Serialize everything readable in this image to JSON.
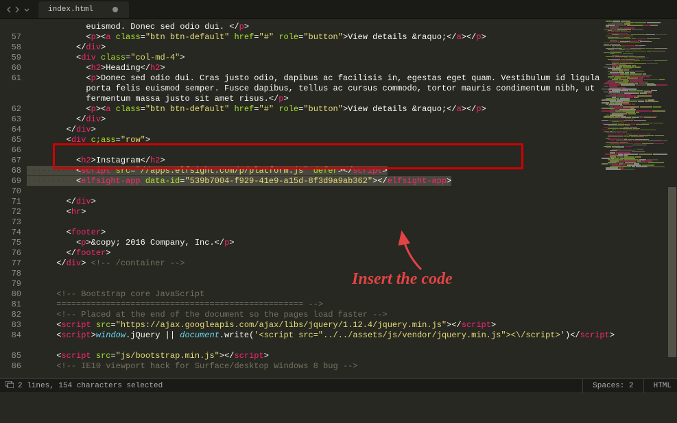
{
  "tab": {
    "filename": "index.html",
    "modified": true
  },
  "annotation": {
    "text": "Insert the code"
  },
  "status": {
    "selection_icon": "⧉",
    "selection": "2 lines, 154 characters selected",
    "spaces": "Spaces: 2",
    "syntax": "HTML"
  },
  "gutter": [
    "",
    "57",
    "58",
    "59",
    "60",
    "61",
    "",
    "",
    "62",
    "63",
    "64",
    "65",
    "66",
    "67",
    "68",
    "69",
    "70",
    "71",
    "72",
    "73",
    "74",
    "75",
    "76",
    "77",
    "78",
    "79",
    "80",
    "81",
    "82",
    "83",
    "84",
    "",
    "85",
    "86",
    ""
  ],
  "lines": [
    {
      "indent": 12,
      "t": [
        [
          "txt",
          "euismod. Donec sed odio dui. "
        ],
        [
          "punct",
          "</"
        ],
        [
          "tag",
          "p"
        ],
        [
          "punct",
          ">"
        ]
      ]
    },
    {
      "indent": 12,
      "t": [
        [
          "punct",
          "<"
        ],
        [
          "tag",
          "p"
        ],
        [
          "punct",
          "><"
        ],
        [
          "tag",
          "a"
        ],
        [
          "txt",
          " "
        ],
        [
          "attr",
          "class"
        ],
        [
          "punct",
          "="
        ],
        [
          "str",
          "\"btn btn-default\""
        ],
        [
          "txt",
          " "
        ],
        [
          "attr",
          "href"
        ],
        [
          "punct",
          "="
        ],
        [
          "str",
          "\"#\""
        ],
        [
          "txt",
          " "
        ],
        [
          "attr",
          "role"
        ],
        [
          "punct",
          "="
        ],
        [
          "str",
          "\"button\""
        ],
        [
          "punct",
          ">"
        ],
        [
          "txt",
          "View details &raquo;"
        ],
        [
          "punct",
          "</"
        ],
        [
          "tag",
          "a"
        ],
        [
          "punct",
          "></"
        ],
        [
          "tag",
          "p"
        ],
        [
          "punct",
          ">"
        ]
      ]
    },
    {
      "indent": 10,
      "t": [
        [
          "punct",
          "</"
        ],
        [
          "tag",
          "div"
        ],
        [
          "punct",
          ">"
        ]
      ]
    },
    {
      "indent": 10,
      "t": [
        [
          "punct",
          "<"
        ],
        [
          "tag",
          "div"
        ],
        [
          "txt",
          " "
        ],
        [
          "attr",
          "class"
        ],
        [
          "punct",
          "="
        ],
        [
          "str",
          "\"col-md-4\""
        ],
        [
          "punct",
          ">"
        ]
      ]
    },
    {
      "indent": 12,
      "t": [
        [
          "punct",
          "<"
        ],
        [
          "tag",
          "h2"
        ],
        [
          "punct",
          ">"
        ],
        [
          "txt",
          "Heading"
        ],
        [
          "punct",
          "</"
        ],
        [
          "tag",
          "h2"
        ],
        [
          "punct",
          ">"
        ]
      ]
    },
    {
      "indent": 12,
      "t": [
        [
          "punct",
          "<"
        ],
        [
          "tag",
          "p"
        ],
        [
          "punct",
          ">"
        ],
        [
          "txt",
          "Donec sed odio dui. Cras justo odio, dapibus ac facilisis in, egestas eget quam. Vestibulum id ligula"
        ]
      ]
    },
    {
      "indent": 12,
      "t": [
        [
          "txt",
          "porta felis euismod semper. Fusce dapibus, tellus ac cursus commodo, tortor mauris condimentum nibh, ut"
        ]
      ]
    },
    {
      "indent": 12,
      "t": [
        [
          "txt",
          "fermentum massa justo sit amet risus."
        ],
        [
          "punct",
          "</"
        ],
        [
          "tag",
          "p"
        ],
        [
          "punct",
          ">"
        ]
      ]
    },
    {
      "indent": 12,
      "t": [
        [
          "punct",
          "<"
        ],
        [
          "tag",
          "p"
        ],
        [
          "punct",
          "><"
        ],
        [
          "tag",
          "a"
        ],
        [
          "txt",
          " "
        ],
        [
          "attr",
          "class"
        ],
        [
          "punct",
          "="
        ],
        [
          "str",
          "\"btn btn-default\""
        ],
        [
          "txt",
          " "
        ],
        [
          "attr",
          "href"
        ],
        [
          "punct",
          "="
        ],
        [
          "str",
          "\"#\""
        ],
        [
          "txt",
          " "
        ],
        [
          "attr",
          "role"
        ],
        [
          "punct",
          "="
        ],
        [
          "str",
          "\"button\""
        ],
        [
          "punct",
          ">"
        ],
        [
          "txt",
          "View details &raquo;"
        ],
        [
          "punct",
          "</"
        ],
        [
          "tag",
          "a"
        ],
        [
          "punct",
          "></"
        ],
        [
          "tag",
          "p"
        ],
        [
          "punct",
          ">"
        ]
      ]
    },
    {
      "indent": 10,
      "t": [
        [
          "punct",
          "</"
        ],
        [
          "tag",
          "div"
        ],
        [
          "punct",
          ">"
        ]
      ]
    },
    {
      "indent": 8,
      "t": [
        [
          "punct",
          "</"
        ],
        [
          "tag",
          "div"
        ],
        [
          "punct",
          ">"
        ]
      ]
    },
    {
      "indent": 8,
      "t": [
        [
          "punct",
          "<"
        ],
        [
          "tag",
          "div"
        ],
        [
          "txt",
          " "
        ],
        [
          "attr",
          "c;ass"
        ],
        [
          "punct",
          "="
        ],
        [
          "str",
          "\"row\""
        ],
        [
          "punct",
          ">"
        ]
      ]
    },
    {
      "indent": 0,
      "t": []
    },
    {
      "indent": 10,
      "t": [
        [
          "punct",
          "<"
        ],
        [
          "tag",
          "h2"
        ],
        [
          "punct",
          ">"
        ],
        [
          "txt",
          "Instagram"
        ],
        [
          "punct",
          "</"
        ],
        [
          "tag",
          "h2"
        ],
        [
          "punct",
          ">"
        ]
      ]
    },
    {
      "indent": 0,
      "sel": true,
      "ws": "··········",
      "t": [
        [
          "punct",
          "<"
        ],
        [
          "tag",
          "script"
        ],
        [
          "ws",
          "·"
        ],
        [
          "attr",
          "src"
        ],
        [
          "punct",
          "="
        ],
        [
          "str",
          "\"//apps.elfsight.com/p/platform.js\""
        ],
        [
          "ws",
          "·"
        ],
        [
          "attr",
          "defer"
        ],
        [
          "punct",
          "></"
        ],
        [
          "tag",
          "script"
        ],
        [
          "punct",
          ">"
        ]
      ]
    },
    {
      "indent": 0,
      "sel": true,
      "ws": "··········",
      "t": [
        [
          "punct",
          "<"
        ],
        [
          "tag",
          "elfsight-app"
        ],
        [
          "ws",
          "·"
        ],
        [
          "attr",
          "data-id"
        ],
        [
          "punct",
          "="
        ],
        [
          "str",
          "\"539b7004-f929-41e9-a15d-8f3d9a9ab362\""
        ],
        [
          "punct",
          "></"
        ],
        [
          "tag",
          "elfsight-app"
        ],
        [
          "punct",
          ">"
        ]
      ]
    },
    {
      "indent": 0,
      "t": []
    },
    {
      "indent": 8,
      "t": [
        [
          "punct",
          "</"
        ],
        [
          "tag",
          "div"
        ],
        [
          "punct",
          ">"
        ]
      ]
    },
    {
      "indent": 8,
      "t": [
        [
          "punct",
          "<"
        ],
        [
          "tag",
          "hr"
        ],
        [
          "punct",
          ">"
        ]
      ]
    },
    {
      "indent": 0,
      "t": []
    },
    {
      "indent": 8,
      "t": [
        [
          "punct",
          "<"
        ],
        [
          "tag",
          "footer"
        ],
        [
          "punct",
          ">"
        ]
      ]
    },
    {
      "indent": 10,
      "t": [
        [
          "punct",
          "<"
        ],
        [
          "tag",
          "p"
        ],
        [
          "punct",
          ">"
        ],
        [
          "txt",
          "&copy; 2016 Company, Inc."
        ],
        [
          "punct",
          "</"
        ],
        [
          "tag",
          "p"
        ],
        [
          "punct",
          ">"
        ]
      ]
    },
    {
      "indent": 8,
      "t": [
        [
          "punct",
          "</"
        ],
        [
          "tag",
          "footer"
        ],
        [
          "punct",
          ">"
        ]
      ]
    },
    {
      "indent": 6,
      "t": [
        [
          "punct",
          "</"
        ],
        [
          "tag",
          "div"
        ],
        [
          "punct",
          ">"
        ],
        [
          "txt",
          " "
        ],
        [
          "cmt",
          "<!-- /container -->"
        ]
      ]
    },
    {
      "indent": 0,
      "t": []
    },
    {
      "indent": 0,
      "t": []
    },
    {
      "indent": 6,
      "t": [
        [
          "cmt",
          "<!-- Bootstrap core JavaScript"
        ]
      ]
    },
    {
      "indent": 6,
      "t": [
        [
          "cmt",
          "================================================== -->"
        ]
      ]
    },
    {
      "indent": 6,
      "t": [
        [
          "cmt",
          "<!-- Placed at the end of the document so the pages load faster -->"
        ]
      ]
    },
    {
      "indent": 6,
      "t": [
        [
          "punct",
          "<"
        ],
        [
          "tag",
          "script"
        ],
        [
          "txt",
          " "
        ],
        [
          "attr",
          "src"
        ],
        [
          "punct",
          "="
        ],
        [
          "str",
          "\"https://ajax.googleapis.com/ajax/libs/jquery/1.12.4/jquery.min.js\""
        ],
        [
          "punct",
          "></"
        ],
        [
          "tag",
          "script"
        ],
        [
          "punct",
          ">"
        ]
      ]
    },
    {
      "indent": 6,
      "t": [
        [
          "punct",
          "<"
        ],
        [
          "tag",
          "script"
        ],
        [
          "punct",
          ">"
        ],
        [
          "glob",
          "window"
        ],
        [
          "txt",
          ".jQuery || "
        ],
        [
          "glob",
          "document"
        ],
        [
          "txt",
          ".write("
        ],
        [
          "str",
          "'<script src=\"../../assets/js/vendor/jquery.min.js\"><\\/script>'"
        ],
        [
          "txt",
          ")"
        ],
        [
          "punct",
          "</"
        ],
        [
          "tag",
          "script"
        ],
        [
          "punct",
          ">"
        ]
      ]
    },
    {
      "indent": 0,
      "t": []
    },
    {
      "indent": 6,
      "t": [
        [
          "punct",
          "<"
        ],
        [
          "tag",
          "script"
        ],
        [
          "txt",
          " "
        ],
        [
          "attr",
          "src"
        ],
        [
          "punct",
          "="
        ],
        [
          "str",
          "\"js/bootstrap.min.js\""
        ],
        [
          "punct",
          "></"
        ],
        [
          "tag",
          "script"
        ],
        [
          "punct",
          ">"
        ]
      ]
    },
    {
      "indent": 6,
      "t": [
        [
          "cmt",
          "<!-- IE10 viewport hack for Surface/desktop Windows 8 bug -->"
        ]
      ]
    }
  ]
}
